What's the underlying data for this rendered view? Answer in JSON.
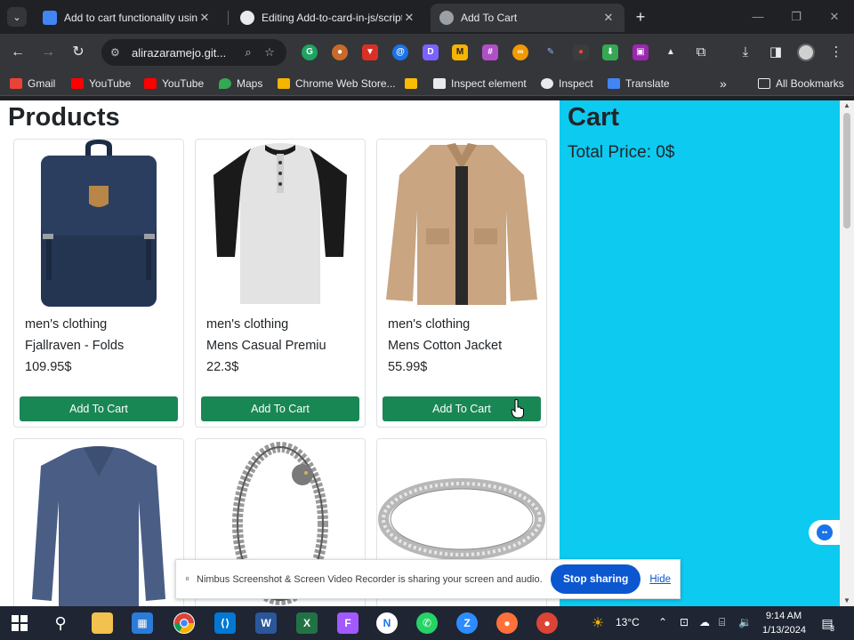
{
  "browser": {
    "tabs": [
      {
        "title": "Add to cart functionality using j",
        "active": false
      },
      {
        "title": "Editing Add-to-card-in-js/script",
        "active": false
      },
      {
        "title": "Add To Cart",
        "active": true
      }
    ],
    "url": "alirazaramejo.git...",
    "bookmarks": [
      {
        "label": "Gmail",
        "icon": "gmail-icon",
        "color": "#ea4335"
      },
      {
        "label": "YouTube",
        "icon": "youtube-icon",
        "color": "#ff0000"
      },
      {
        "label": "YouTube",
        "icon": "youtube-icon",
        "color": "#ff0000"
      },
      {
        "label": "Maps",
        "icon": "maps-icon",
        "color": "#34a853"
      },
      {
        "label": "Chrome Web Store...",
        "icon": "webstore-icon",
        "color": "#f4b400"
      },
      {
        "label": "",
        "icon": "extension-bookmark-icon",
        "color": "#fbbc04"
      },
      {
        "label": "Inspect element",
        "icon": "page-icon",
        "color": "#e8eaed"
      },
      {
        "label": "Inspect",
        "icon": "globe-icon",
        "color": "#e8eaed"
      },
      {
        "label": "Translate",
        "icon": "translate-icon",
        "color": "#4285f4"
      }
    ],
    "all_bookmarks": "All Bookmarks"
  },
  "page": {
    "products_title": "Products",
    "button_color": "#198754",
    "cart_color": "#0dcaf0",
    "products": [
      {
        "category": "men's clothing",
        "name": "Fjallraven - Folds",
        "price": "109.95$",
        "button": "Add To Cart",
        "image": "backpack"
      },
      {
        "category": "men's clothing",
        "name": "Mens Casual Premiu",
        "price": "22.3$",
        "button": "Add To Cart",
        "image": "raglan-shirt"
      },
      {
        "category": "men's clothing",
        "name": "Mens Cotton Jacket",
        "price": "55.99$",
        "button": "Add To Cart",
        "image": "jacket"
      },
      {
        "category": "",
        "name": "",
        "price": "",
        "button": "",
        "image": "long-sleeve-shirt"
      },
      {
        "category": "",
        "name": "",
        "price": "",
        "button": "",
        "image": "dragon-bracelet"
      },
      {
        "category": "",
        "name": "",
        "price": "",
        "button": "",
        "image": "silver-ring"
      }
    ],
    "cart": {
      "title": "Cart",
      "total_label": "Total Price: 0$"
    }
  },
  "share_banner": {
    "message": "Nimbus Screenshot & Screen Video Recorder is sharing your screen and audio.",
    "stop_label": "Stop sharing",
    "hide_label": "Hide"
  },
  "taskbar": {
    "weather": "13°C",
    "time": "9:14 AM",
    "date": "1/13/2024",
    "notification_count": "3"
  }
}
